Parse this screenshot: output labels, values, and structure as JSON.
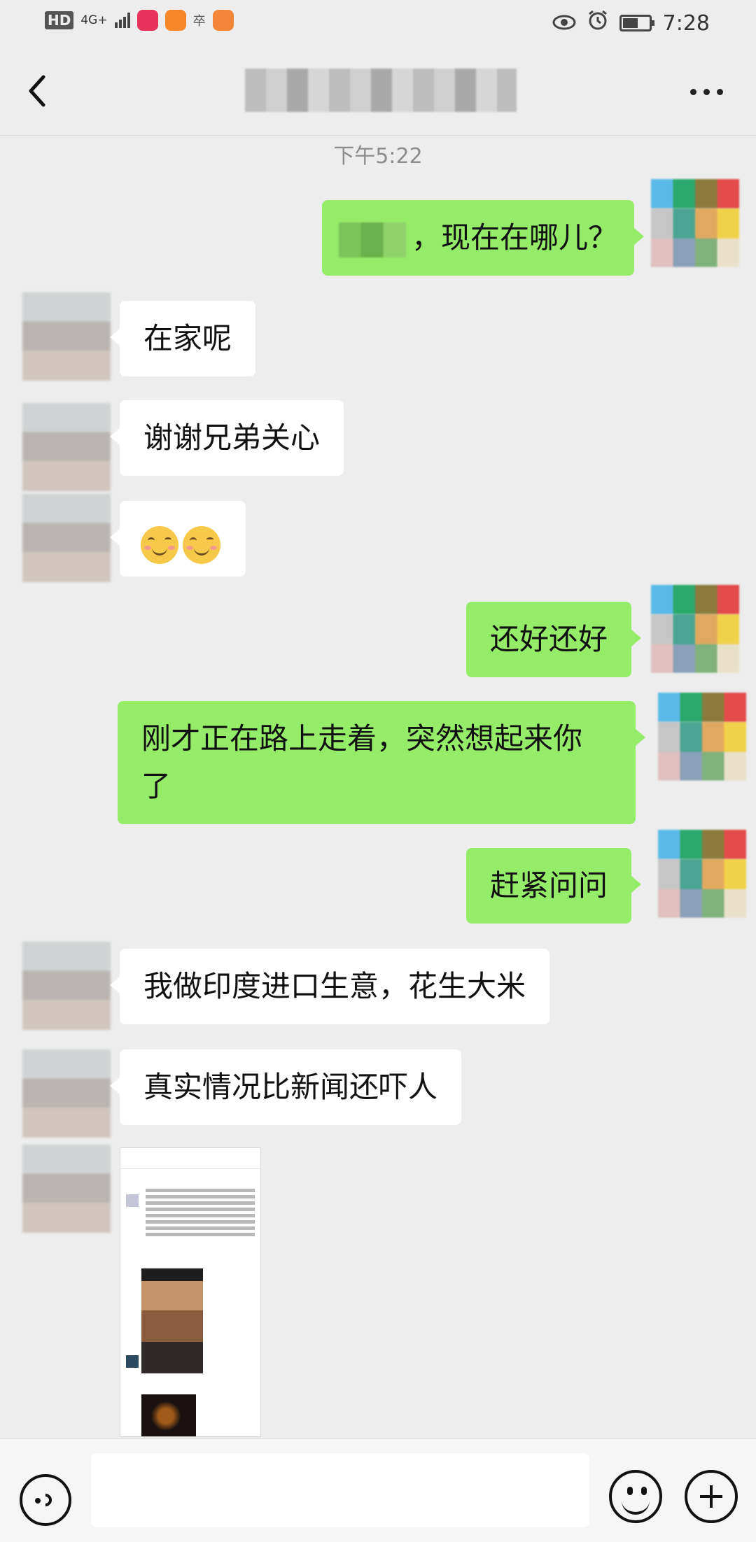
{
  "status_bar": {
    "hd": "HD",
    "network": "4G+",
    "time": "7:28",
    "battery_level": 0.6,
    "icons": [
      "eye-icon",
      "alarm-icon",
      "battery-icon"
    ]
  },
  "header": {
    "back_icon": "chevron-left-icon",
    "more_icon": "more-dots-icon"
  },
  "chat": {
    "timestamp": "下午5:22",
    "messages": [
      {
        "side": "out",
        "text": "，现在在哪儿？"
      },
      {
        "side": "in",
        "text": "在家呢"
      },
      {
        "side": "in",
        "text": "谢谢兄弟关心"
      },
      {
        "side": "in",
        "text": "emoji-smile-icon x2"
      },
      {
        "side": "out",
        "text": "还好还好"
      },
      {
        "side": "out",
        "text": "刚才正在路上走着，突然想起来你了"
      },
      {
        "side": "out",
        "text": "赶紧问问"
      },
      {
        "side": "in",
        "text": "我做印度进口生意，花生大米"
      },
      {
        "side": "in",
        "text": "真实情况比新闻还吓人"
      },
      {
        "side": "in",
        "text": "image-screenshot"
      }
    ],
    "m1": "，现在在哪儿？",
    "m2": "在家呢",
    "m3": "谢谢兄弟关心",
    "m5": "还好还好",
    "m6_line1": "刚才正在路上走着，突然想起来你",
    "m6_line2": "了",
    "m7": "赶紧问问",
    "m8": "我做印度进口生意，花生大米",
    "m9": "真实情况比新闻还吓人"
  },
  "input_bar": {
    "voice_icon": "voice-icon",
    "emoji_icon": "emoji-icon",
    "plus_icon": "plus-icon",
    "input_value": ""
  },
  "colors": {
    "background": "#ededed",
    "bubble_out": "#95ec69",
    "bubble_in": "#ffffff",
    "timestamp": "#8c8c8c"
  }
}
